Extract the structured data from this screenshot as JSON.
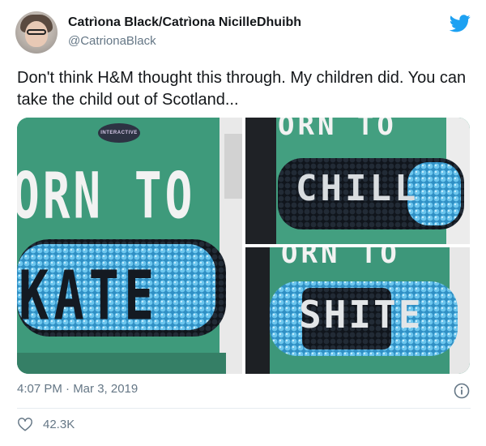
{
  "author": {
    "display_name": "Catrìona Black/Catrìona NicilleDhuibh",
    "handle": "@CatrionaBlack"
  },
  "tweet": {
    "text": "Don't think H&M thought this through. My children did. You can take the child out of Scotland..."
  },
  "media": {
    "photos": [
      {
        "sticker": "INTERACTIVE",
        "top_text": "ORN TO",
        "sequin_text": "KATE"
      },
      {
        "top_text": "ORN TO",
        "sequin_text": "CHILL"
      },
      {
        "top_text": "ORN TO",
        "sequin_text": "SHITE"
      }
    ]
  },
  "meta": {
    "timestamp": "4:07 PM · Mar 3, 2019"
  },
  "engagement": {
    "likes": "42.3K"
  },
  "colors": {
    "twitter_blue": "#1da1f2",
    "secondary_text": "#657786",
    "shirt_green": "#3e9a7b",
    "sequin_blue": "#3fa6d8",
    "sequin_dark": "#1c2430",
    "sequin_silver": "#d9dde0"
  },
  "icons": {
    "brand": "twitter-bird-icon",
    "info": "info-circle-icon",
    "like": "heart-outline-icon"
  }
}
